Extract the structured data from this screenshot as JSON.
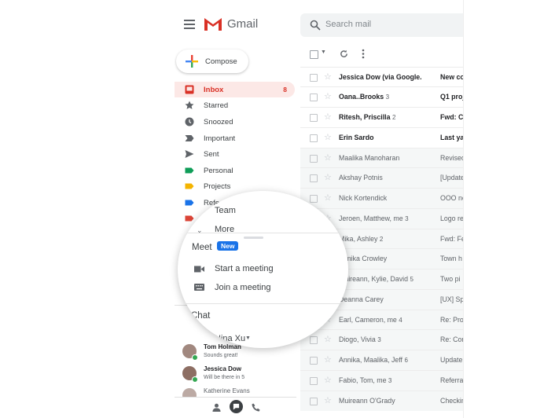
{
  "header": {
    "app_name": "Gmail",
    "search_placeholder": "Search mail"
  },
  "compose_label": "Compose",
  "sidebar": {
    "items": [
      {
        "label": "Inbox",
        "count": "8",
        "icon": "inbox-icon",
        "color": "#d93025"
      },
      {
        "label": "Starred",
        "icon": "star-icon",
        "color": "#5f6368"
      },
      {
        "label": "Snoozed",
        "icon": "clock-icon",
        "color": "#5f6368"
      },
      {
        "label": "Important",
        "icon": "important-icon",
        "color": "#5f6368"
      },
      {
        "label": "Sent",
        "icon": "send-icon",
        "color": "#5f6368"
      },
      {
        "label": "Personal",
        "icon": "label-icon",
        "color": "#0f9d58"
      },
      {
        "label": "Projects",
        "icon": "label-icon",
        "color": "#f4b400"
      },
      {
        "label": "Refe",
        "icon": "label-icon",
        "color": "#1a73e8"
      },
      {
        "label": "",
        "icon": "label-icon",
        "color": "#db4437"
      }
    ]
  },
  "magnifier": {
    "team": "Team",
    "more": "More",
    "meet_title": "Meet",
    "new_badge": "New",
    "start_meeting": "Start a meeting",
    "join_meeting": "Join a meeting",
    "chat_title": "Chat",
    "chat_user": "Nina Xu"
  },
  "contacts": [
    {
      "name": "Tom Holman",
      "status": "Sounds great!",
      "online": true,
      "color": "#a1887f"
    },
    {
      "name": "Jessica Dow",
      "status": "Will be there in 5",
      "online": true,
      "color": "#8d6e63"
    },
    {
      "name": "Katherine Evans",
      "status": "",
      "online": false,
      "color": "#bcaaa4"
    }
  ],
  "emails": [
    {
      "from": "Jessica Dow (via Google.",
      "count": "",
      "subject": "New co",
      "unread": true
    },
    {
      "from": "Oana..Brooks",
      "count": "3",
      "subject": "Q1 proj",
      "unread": true
    },
    {
      "from": "Ritesh, Priscilla",
      "count": "2",
      "subject": "Fwd: Cl",
      "unread": true
    },
    {
      "from": "Erin Sardo",
      "count": "",
      "subject": "Last ya",
      "unread": true
    },
    {
      "from": "Maalika Manoharan",
      "count": "",
      "subject": "Revised",
      "unread": false
    },
    {
      "from": "Akshay Potnis",
      "count": "",
      "subject": "[Update",
      "unread": false
    },
    {
      "from": "Nick Kortendick",
      "count": "",
      "subject": "OOO ne",
      "unread": false
    },
    {
      "from": "Jeroen, Matthew, me",
      "count": "3",
      "subject": "Logo re",
      "unread": false
    },
    {
      "from": "Mika, Ashley",
      "count": "2",
      "subject": "Fwd: Fe",
      "unread": false
    },
    {
      "from": "Annika Crowley",
      "count": "",
      "subject": "Town h",
      "unread": false
    },
    {
      "from": "Muireann, Kylie, David",
      "count": "5",
      "subject": "Two pi",
      "unread": false
    },
    {
      "from": "Deanna Carey",
      "count": "",
      "subject": "[UX] Sp",
      "unread": false
    },
    {
      "from": "Earl, Cameron, me",
      "count": "4",
      "subject": "Re: Pro",
      "unread": false
    },
    {
      "from": "Diogo, Vivia",
      "count": "3",
      "subject": "Re: Cor",
      "unread": false
    },
    {
      "from": "Annika, Maalika, Jeff",
      "count": "6",
      "subject": "Update",
      "unread": false
    },
    {
      "from": "Fabio, Tom, me",
      "count": "3",
      "subject": "Referra",
      "unread": false
    },
    {
      "from": "Muireann O'Grady",
      "count": "",
      "subject": "Checkir",
      "unread": false
    }
  ]
}
